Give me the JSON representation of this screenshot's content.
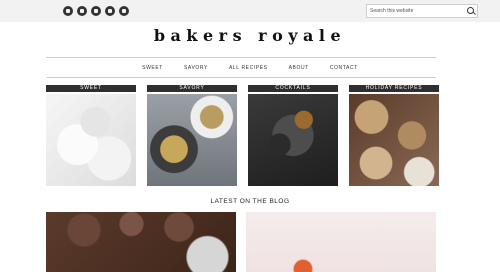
{
  "header": {
    "social_icons": [
      "facebook-icon",
      "google-plus-icon",
      "instagram-icon",
      "pinterest-icon",
      "twitter-icon"
    ],
    "search": {
      "placeholder": "Search this website"
    }
  },
  "logo": {
    "text": "bakers royale"
  },
  "nav": {
    "items": [
      "SWEET",
      "SAVORY",
      "ALL RECIPES",
      "ABOUT",
      "CONTACT"
    ]
  },
  "categories": [
    {
      "label": "SWEET"
    },
    {
      "label": "SAVORY"
    },
    {
      "label": "COCKTAILS"
    },
    {
      "label": "HOLIDAY RECIPES"
    }
  ],
  "blog": {
    "title": "LATEST ON THE BLOG"
  },
  "colors": {
    "topbar": "#f2f2f2",
    "label_bar": "#2f2f2f"
  }
}
